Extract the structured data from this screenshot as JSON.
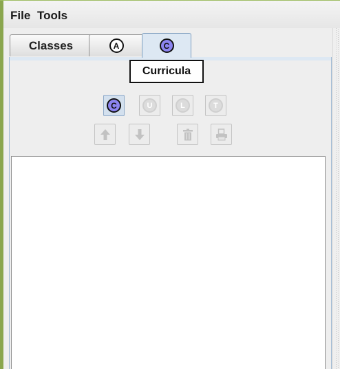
{
  "menu": {
    "file": "File",
    "tools": "Tools"
  },
  "tabs": [
    {
      "label": "Classes"
    },
    {
      "label": "A"
    },
    {
      "label": "C"
    }
  ],
  "tooltip": "Curricula",
  "toolbar": {
    "row1": [
      {
        "letter": "C",
        "enabled": true
      },
      {
        "letter": "U",
        "enabled": false
      },
      {
        "letter": "L",
        "enabled": false
      },
      {
        "letter": "T",
        "enabled": false
      }
    ],
    "row2_icons": [
      "move-up-icon",
      "move-down-icon",
      "trash-icon",
      "print-icon"
    ]
  },
  "colors": {
    "window_border": "#9dbc62",
    "selected_tab": "#dde8f3",
    "active_circle": "#8c84f0"
  }
}
